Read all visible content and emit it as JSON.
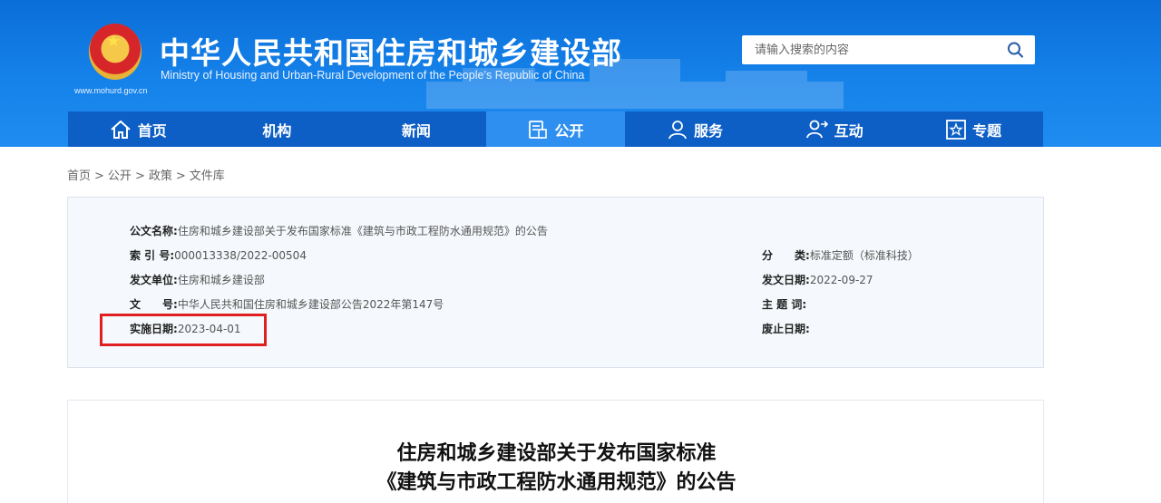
{
  "header": {
    "title_cn": "中华人民共和国住房和城乡建设部",
    "title_en": "Ministry of Housing and Urban-Rural Development of the People’s Republic of China",
    "url": "www.mohurd.gov.cn",
    "emblem": "national-emblem",
    "search_placeholder": "请输入搜索的内容",
    "search_icon": "search-icon"
  },
  "nav": {
    "items": [
      {
        "label": "首页",
        "icon": "home-icon"
      },
      {
        "label": "机构",
        "icon": ""
      },
      {
        "label": "新闻",
        "icon": ""
      },
      {
        "label": "公开",
        "icon": "document-icon",
        "active": true
      },
      {
        "label": "服务",
        "icon": "service-person-icon"
      },
      {
        "label": "互动",
        "icon": "interact-icon"
      },
      {
        "label": "专题",
        "icon": "star-icon"
      }
    ]
  },
  "breadcrumb": [
    "首页",
    "公开",
    "政策",
    "文件库"
  ],
  "info": {
    "doc_name_key": "公文名称:",
    "doc_name_val": "住房和城乡建设部关于发布国家标准《建筑与市政工程防水通用规范》的公告",
    "index_key": "索 引 号:",
    "index_val": "000013338/2022-00504",
    "unit_key": "发文单位:",
    "unit_val": "住房和城乡建设部",
    "docno_key": "文　　号:",
    "docno_val": "中华人民共和国住房和城乡建设部公告2022年第147号",
    "impl_key": "实施日期:",
    "impl_val": "2023-04-01",
    "category_key": "分　　类:",
    "category_val": "标准定额（标准科技）",
    "date_key": "发文日期:",
    "date_val": "2022-09-27",
    "subject_key": "主 题 词:",
    "subject_val": "",
    "abolish_key": "废止日期:",
    "abolish_val": ""
  },
  "article": {
    "title_line1": "住房和城乡建设部关于发布国家标准",
    "title_line2": "《建筑与市政工程防水通用规范》的公告"
  },
  "colors": {
    "header_blue": "#1582ea",
    "nav_blue": "#0d5fc6",
    "nav_active": "#2e8ff0",
    "highlight_red": "#e02020"
  }
}
